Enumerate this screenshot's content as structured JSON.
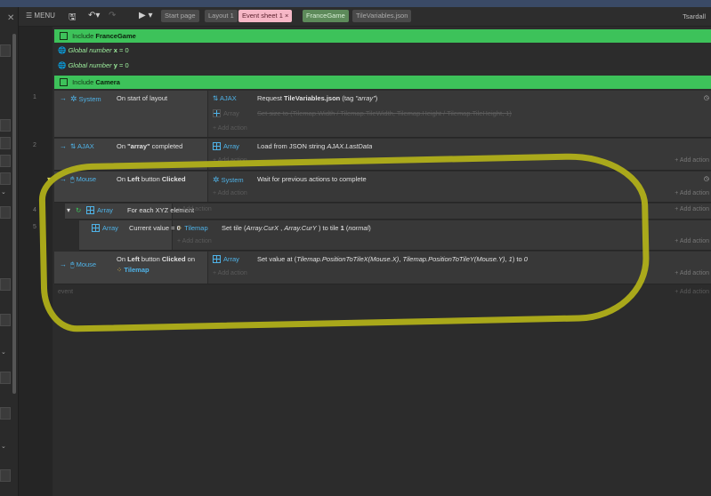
{
  "menubar": {
    "menu_label": "MENU",
    "tabs": [
      {
        "label": "Start page",
        "bg": "#4a4a4a",
        "fg": "#aaaaaa"
      },
      {
        "label": "Layout 1",
        "bg": "#4a4a4a",
        "fg": "#aaaaaa"
      },
      {
        "label": "Event sheet 1 ×",
        "bg": "#f6b7c6",
        "fg": "#5a1f2c"
      },
      {
        "label": "FranceGame",
        "bg": "#5d8a5a",
        "fg": "#d8f0d6"
      },
      {
        "label": "TileVariables.json",
        "bg": "#4a4a4a",
        "fg": "#aaaaaa"
      }
    ],
    "user": "Tsardall"
  },
  "sheet": {
    "include1": {
      "prefix": "Include",
      "name": "FranceGame"
    },
    "global_x": {
      "prefix": "Global number",
      "var": "x",
      "rest": " = 0"
    },
    "global_y": {
      "prefix": "Global number",
      "var": "y",
      "rest": " = 0"
    },
    "include2": {
      "prefix": "Include",
      "name": "Camera"
    },
    "add_action": "+ Add action",
    "add_event": "event",
    "events": {
      "e1": {
        "num": "1",
        "obj": "System",
        "cond": "On start of layout",
        "a1_obj": "AJAX",
        "a1_pre": "Request ",
        "a1_bold": "TileVariables.json",
        "a1_post": " (tag ",
        "a1_tag": "\"array\"",
        "a1_end": ")",
        "a2_obj": "Array",
        "a2_text": "Set size to (Tilemap.Width / Tilemap.TileWidth, Tilemap.Height / Tilemap.TileHeight, 1)"
      },
      "e2": {
        "num": "2",
        "obj": "AJAX",
        "cond_pre": "On ",
        "cond_bold": "\"array\"",
        "cond_post": " completed",
        "a1_obj": "Array",
        "a1_text": "Load from JSON string ",
        "a1_ital": "AJAX.LastData"
      },
      "e3": {
        "obj": "Mouse",
        "cond_pre": "On ",
        "cond_b1": "Left",
        "cond_mid": " button ",
        "cond_b2": "Clicked",
        "a1_obj": "System",
        "a1_text": "Wait for previous actions to complete"
      },
      "e4": {
        "num": "4",
        "obj": "Array",
        "cond": "For each XYZ element"
      },
      "e5": {
        "num": "5",
        "obj": "Array",
        "cond_pre": "Current value = ",
        "cond_bold": "0",
        "a1_obj": "Tilemap",
        "a1_pre": "Set tile (",
        "a1_i1": "Array.CurX",
        "a1_sep": " , ",
        "a1_i2": "Array.CurY",
        "a1_mid": " ) to tile ",
        "a1_bold": "1",
        "a1_open": " (",
        "a1_ital": "normal",
        "a1_close": ")"
      },
      "e6": {
        "obj": "Mouse",
        "cond_pre": "On ",
        "cond_b1": "Left",
        "cond_mid": " button ",
        "cond_b2": "Clicked",
        "cond_post": " on",
        "cond_obj": "Tilemap",
        "a1_obj": "Array",
        "a1_pre": "Set value at (",
        "a1_i1": "Tilemap.PositionToTileX(Mouse.X)",
        "a1_sep": ", ",
        "a1_i2": "Tilemap.PositionToTileY(Mouse.Y)",
        "a1_mid": ", ",
        "a1_i3": "1",
        "a1_end": ") to ",
        "a1_i4": "0"
      }
    }
  },
  "colors": {
    "include_bar": "#3dc25a",
    "object_blue": "#4fb3e8",
    "annotation_ring": "#b7b618"
  }
}
